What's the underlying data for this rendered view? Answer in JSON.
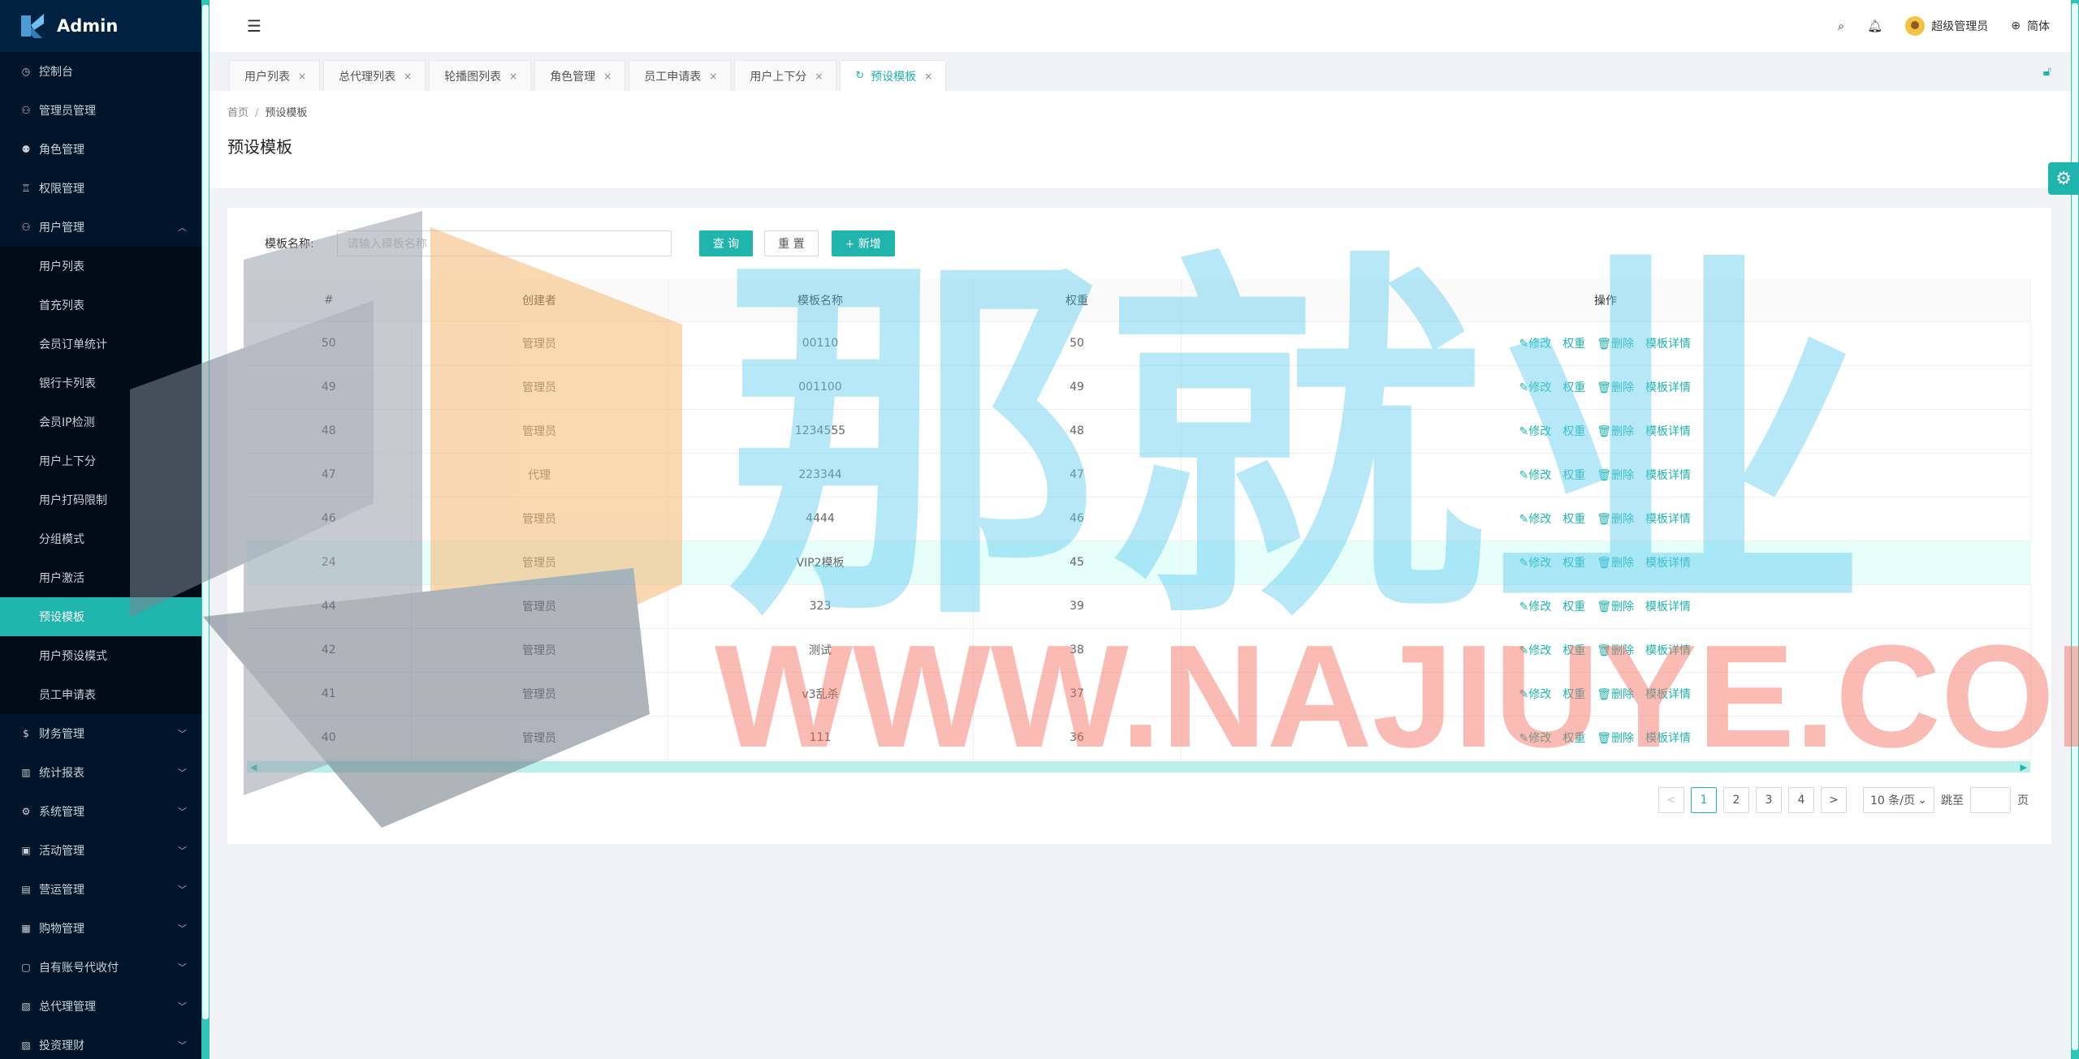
{
  "app": {
    "title": "Admin"
  },
  "sidebar": {
    "items": [
      {
        "label": "控制台",
        "icon": "dashboard-icon"
      },
      {
        "label": "管理员管理",
        "icon": "user-icon"
      },
      {
        "label": "角色管理",
        "icon": "users-icon"
      },
      {
        "label": "权限管理",
        "icon": "lock-icon"
      },
      {
        "label": "用户管理",
        "icon": "user-icon",
        "expanded": true
      }
    ],
    "sub_items": [
      "用户列表",
      "首充列表",
      "会员订单统计",
      "银行卡列表",
      "会员IP检测",
      "用户上下分",
      "用户打码限制",
      "分组模式",
      "用户激活",
      "预设模板",
      "用户预设模式",
      "员工申请表"
    ],
    "active_sub": "预设模板",
    "items_after": [
      {
        "label": "财务管理"
      },
      {
        "label": "统计报表"
      },
      {
        "label": "系统管理"
      },
      {
        "label": "活动管理"
      },
      {
        "label": "营运管理"
      },
      {
        "label": "购物管理"
      },
      {
        "label": "自有账号代收付"
      },
      {
        "label": "总代理管理"
      },
      {
        "label": "投资理财"
      }
    ]
  },
  "header": {
    "user_name": "超级管理员",
    "language": "简体"
  },
  "tabs": [
    {
      "label": "用户列表"
    },
    {
      "label": "总代理列表"
    },
    {
      "label": "轮播图列表"
    },
    {
      "label": "角色管理"
    },
    {
      "label": "员工申请表"
    },
    {
      "label": "用户上下分"
    },
    {
      "label": "预设模板",
      "active": true
    }
  ],
  "breadcrumb": {
    "home": "首页",
    "sep": "/",
    "current": "预设模板"
  },
  "page": {
    "title": "预设模板"
  },
  "search": {
    "label": "模板名称:",
    "placeholder": "请输入模板名称",
    "query_label": "查 询",
    "reset_label": "重 置",
    "add_label": "+ 新增"
  },
  "table": {
    "columns": [
      "#",
      "创建者",
      "模板名称",
      "权重",
      "操作"
    ],
    "actions": [
      "修改",
      "权重",
      "删除",
      "模板详情"
    ],
    "rows": [
      {
        "id": "50",
        "creator": "管理员",
        "name": "00110",
        "weight": "50"
      },
      {
        "id": "49",
        "creator": "管理员",
        "name": "001100",
        "weight": "49"
      },
      {
        "id": "48",
        "creator": "管理员",
        "name": "1234555",
        "weight": "48"
      },
      {
        "id": "47",
        "creator": "代理",
        "name": "223344",
        "weight": "47"
      },
      {
        "id": "46",
        "creator": "管理员",
        "name": "4444",
        "weight": "46"
      },
      {
        "id": "24",
        "creator": "管理员",
        "name": "VIP2模板",
        "weight": "45",
        "highlight": true
      },
      {
        "id": "44",
        "creator": "管理员",
        "name": "323",
        "weight": "39"
      },
      {
        "id": "42",
        "creator": "管理员",
        "name": "测试",
        "weight": "38"
      },
      {
        "id": "41",
        "creator": "管理员",
        "name": "v3乱杀",
        "weight": "37"
      },
      {
        "id": "40",
        "creator": "管理员",
        "name": "111",
        "weight": "36"
      }
    ]
  },
  "pagination": {
    "prev": "<",
    "next": ">",
    "pages": [
      "1",
      "2",
      "3",
      "4"
    ],
    "current": "1",
    "size_label": "10 条/页",
    "jump_label": "跳至",
    "page_suffix": "页"
  },
  "watermark": {
    "line1": "那就业",
    "line2": "WWW.NAJIUYE.COM"
  },
  "colors": {
    "accent": "#1fb5ad",
    "sidebar_bg": "#001529",
    "submenu_bg": "#000c17"
  }
}
